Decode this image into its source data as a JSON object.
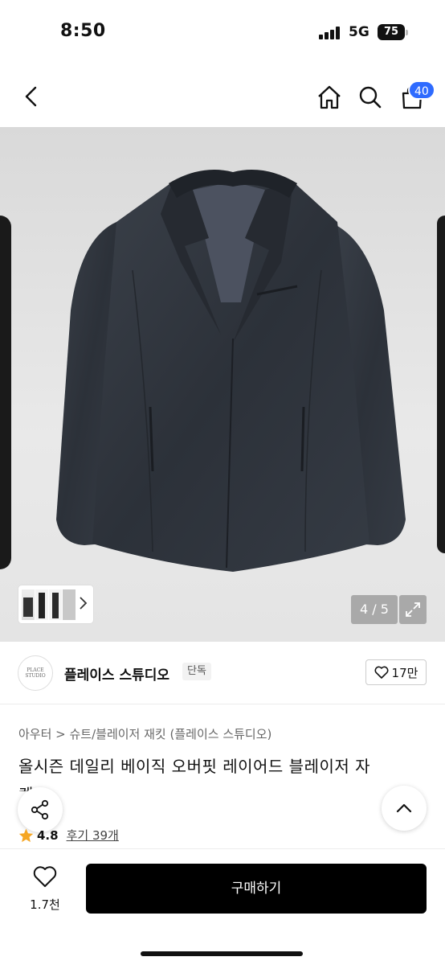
{
  "status_bar": {
    "time": "8:50",
    "network": "5G",
    "battery": "75"
  },
  "nav": {
    "back_icon": "chevron-left-icon",
    "home_icon": "home-icon",
    "search_icon": "search-icon",
    "cart_icon": "cart-icon",
    "cart_count": "40",
    "badge_color": "#2e6bff"
  },
  "gallery": {
    "pager": "4 / 5",
    "expand_icon": "expand-icon",
    "thumbnails_icon": "chevron-right-icon"
  },
  "brand": {
    "logo_text": "PLACE STUDIO",
    "name": "플레이스 스튜디오",
    "tag": "단독",
    "likes": "17만"
  },
  "product": {
    "breadcrumb": "아우터 > 슈트/블레이저 재킷 (플레이스 스튜디오)",
    "title": "올시즌 데일리 베이직 오버핏 레이어드 블레이저 자",
    "title_tail": "켓",
    "rating": "4.8",
    "review_link": "후기 39개"
  },
  "bottom": {
    "wish_count": "1.7천",
    "buy_label": "구매하기"
  }
}
